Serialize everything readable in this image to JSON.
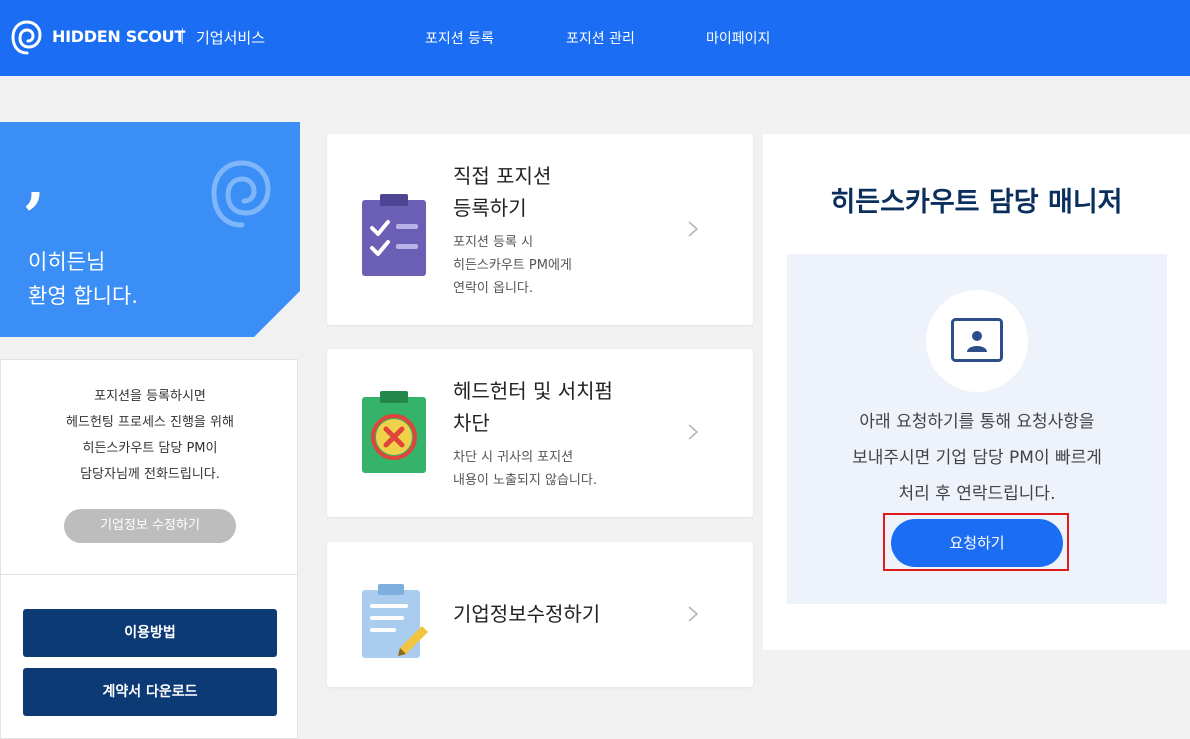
{
  "header": {
    "brand": "HIDDEN SCOUT",
    "service": "기업서비스",
    "nav": [
      "포지션 등록",
      "포지션 관리",
      "마이페이지"
    ]
  },
  "welcome": {
    "name": "이히든님",
    "message": "환영 합니다."
  },
  "info": {
    "lines": [
      "포지션을 등록하시면",
      "헤드헌팅 프로세스 진행을 위해",
      "히든스카우트 담당 PM이",
      "담당자님께 전화드립니다."
    ],
    "edit_button": "기업정보 수정하기",
    "guide_button": "이용방법",
    "contract_button": "계약서 다운로드"
  },
  "cards": [
    {
      "title_lines": [
        "직접 포지션",
        "등록하기"
      ],
      "desc_lines": [
        "포지션 등록 시",
        "히든스카우트 PM에게",
        "연락이 옵니다."
      ],
      "icon": "clipboard-check-icon"
    },
    {
      "title_lines": [
        "헤드헌터 및 서치펌",
        "차단"
      ],
      "desc_lines": [
        "차단 시 귀사의 포지션",
        "내용이 노출되지 않습니다."
      ],
      "icon": "clipboard-block-icon"
    },
    {
      "title_lines": [
        "기업정보수정하기"
      ],
      "desc_lines": [],
      "icon": "clipboard-edit-icon"
    }
  ],
  "manager": {
    "title": "히든스카우트 담당 매니저",
    "desc_lines": [
      "아래 요청하기를 통해 요청사항을",
      "보내주시면 기업 담당 PM이 빠르게",
      "처리 후 연락드립니다."
    ],
    "request_button": "요청하기"
  },
  "colors": {
    "primary": "#1b6ef3",
    "welcome": "#3a8ef6",
    "dark": "#0b3a75",
    "title": "#0b2f5c",
    "highlight": "#e01b1b"
  }
}
